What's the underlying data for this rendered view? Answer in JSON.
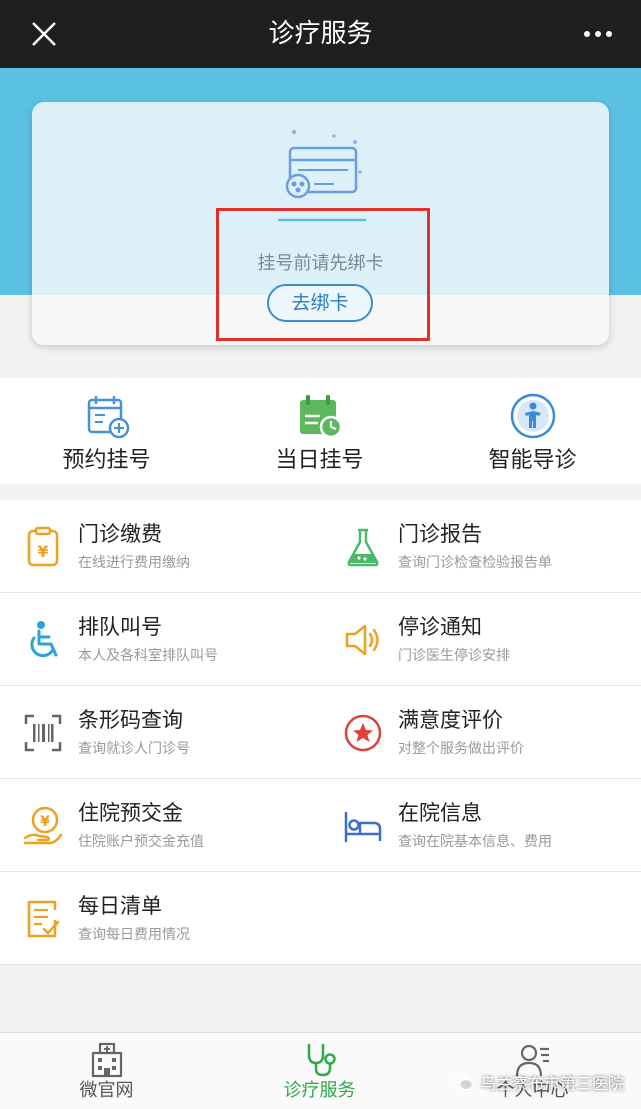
{
  "header": {
    "title": "诊疗服务",
    "close_icon": "close-icon",
    "more_icon": "more-dots-icon"
  },
  "bind_card": {
    "prompt": "挂号前请先绑卡",
    "button": "去绑卡",
    "illustration": "id-card-icon"
  },
  "quick_actions": [
    {
      "label": "预约挂号",
      "icon": "calendar-plus-icon",
      "color": "#4a90d9"
    },
    {
      "label": "当日挂号",
      "icon": "calendar-clock-icon",
      "color": "#5cb85c"
    },
    {
      "label": "智能导诊",
      "icon": "guide-person-icon",
      "color": "#3a8ad6"
    }
  ],
  "services": [
    {
      "title": "门诊缴费",
      "subtitle": "在线进行费用缴纳",
      "icon": "payment-clipboard-icon",
      "color": "#f0a020"
    },
    {
      "title": "门诊报告",
      "subtitle": "查询门诊检查检验报告单",
      "icon": "flask-icon",
      "color": "#4bb86a"
    },
    {
      "title": "排队叫号",
      "subtitle": "本人及各科室排队叫号",
      "icon": "wheelchair-icon",
      "color": "#2ea3db"
    },
    {
      "title": "停诊通知",
      "subtitle": "门诊医生停诊安排",
      "icon": "speaker-icon",
      "color": "#f0a020"
    },
    {
      "title": "条形码查询",
      "subtitle": "查询就诊人门诊号",
      "icon": "barcode-scan-icon",
      "color": "#666666"
    },
    {
      "title": "满意度评价",
      "subtitle": "对整个服务做出评价",
      "icon": "star-badge-icon",
      "color": "#e0403a"
    },
    {
      "title": "住院预交金",
      "subtitle": "住院账户预交金充值",
      "icon": "coin-hand-icon",
      "color": "#f0a020"
    },
    {
      "title": "在院信息",
      "subtitle": "查询在院基本信息、费用",
      "icon": "hospital-bed-icon",
      "color": "#3a6fc9"
    },
    {
      "title": "每日清单",
      "subtitle": "查询每日费用情况",
      "icon": "daily-list-icon",
      "color": "#f0a020"
    }
  ],
  "tabs": [
    {
      "label": "微官网",
      "icon": "hospital-building-icon",
      "active": false
    },
    {
      "label": "诊疗服务",
      "icon": "stethoscope-icon",
      "active": true
    },
    {
      "label": "个人中心",
      "icon": "user-profile-icon",
      "active": false
    }
  ],
  "watermark": {
    "text": "乌兰察布市第三医院",
    "icon": "wechat-logo-icon"
  },
  "colors": {
    "topbar": "#1f1f1f",
    "hero": "#5bc2e3",
    "active_tab": "#2eaa4a",
    "highlight": "#e0302a"
  }
}
